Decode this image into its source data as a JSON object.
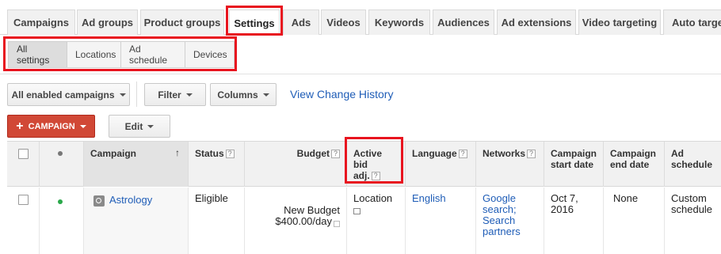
{
  "tabs": [
    {
      "label": "Campaigns"
    },
    {
      "label": "Ad groups"
    },
    {
      "label": "Product groups"
    },
    {
      "label": "Settings",
      "active": true
    },
    {
      "label": "Ads"
    },
    {
      "label": "Videos"
    },
    {
      "label": "Keywords"
    },
    {
      "label": "Audiences"
    },
    {
      "label": "Ad extensions"
    },
    {
      "label": "Video targeting"
    },
    {
      "label": "Auto targets"
    }
  ],
  "subtabs": [
    {
      "label": "All settings",
      "active": true
    },
    {
      "label": "Locations"
    },
    {
      "label": "Ad schedule"
    },
    {
      "label": "Devices"
    }
  ],
  "toolbar": {
    "campaign_filter": "All enabled campaigns",
    "filter": "Filter",
    "columns": "Columns",
    "change_history": "View Change History",
    "add_campaign": "CAMPAIGN",
    "edit": "Edit"
  },
  "table": {
    "headers": {
      "campaign": "Campaign",
      "status": "Status",
      "budget": "Budget",
      "bid_adj_1": "Active bid",
      "bid_adj_2": "adj.",
      "language": "Language",
      "networks": "Networks",
      "start_1": "Campaign",
      "start_2": "start date",
      "end_1": "Campaign",
      "end_2": "end date",
      "sched_1": "Ad",
      "sched_2": "schedule"
    },
    "row": {
      "campaign": "Astrology",
      "status": "Eligible",
      "budget_1": "New Budget",
      "budget_2": "$400.00/day",
      "bid_adj": "Location",
      "language": "English",
      "networks_1": "Google",
      "networks_2": "search;",
      "networks_3": "Search",
      "networks_4": "partners",
      "start_1": "Oct 7,",
      "start_2": "2016",
      "end": "None",
      "sched_1": "Custom",
      "sched_2": "schedule"
    }
  },
  "colors": {
    "highlight": "#e8141f",
    "link": "#1f5db7",
    "add_button": "#d14836",
    "status_enabled": "#2aa84a"
  }
}
